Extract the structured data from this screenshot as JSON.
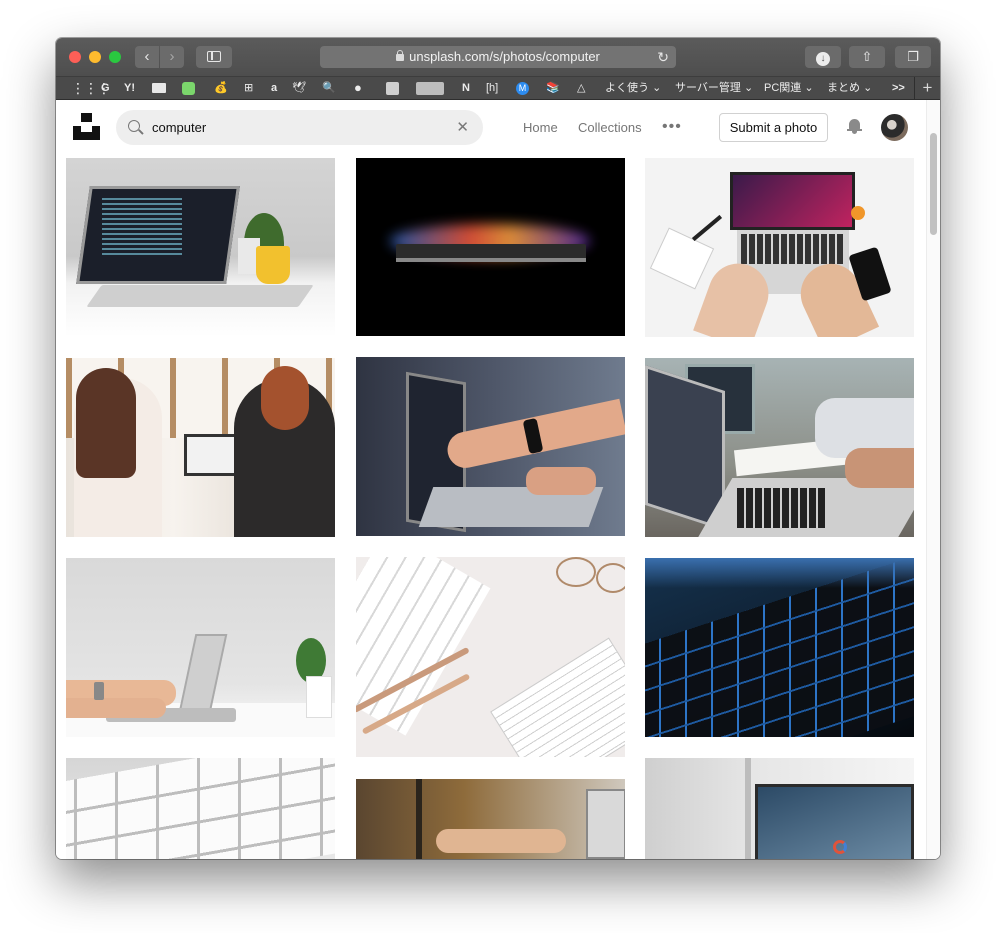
{
  "browser": {
    "url": "unsplash.com/s/photos/computer",
    "back_glyph": "‹",
    "forward_glyph": "›",
    "reload_glyph": "↻",
    "share_glyph": "⇧",
    "tabs_glyph": "❐",
    "download_glyph": "↓"
  },
  "bookmarks": {
    "items": [
      {
        "label": "G",
        "icon": "google-icon"
      },
      {
        "label": "Y!",
        "icon": "yahoo-icon"
      },
      {
        "label": "",
        "icon": "bookmark-icon-1"
      },
      {
        "label": "",
        "icon": "bookmark-icon-2"
      },
      {
        "label": "💰",
        "icon": "money-bag-icon"
      },
      {
        "label": "⊞",
        "icon": "grid-icon"
      },
      {
        "label": "a",
        "icon": "amazon-icon"
      },
      {
        "label": "🕊",
        "icon": "bird-icon"
      },
      {
        "label": "🔍",
        "icon": "magnifier-icon"
      },
      {
        "label": "●",
        "icon": "circle-icon"
      },
      {
        "label": "",
        "icon": "box-icon"
      },
      {
        "label": "",
        "icon": "folder-icon"
      },
      {
        "label": "N",
        "icon": "n-icon"
      },
      {
        "label": "[h]",
        "icon": "hatena-icon"
      },
      {
        "label": "M",
        "icon": "m-icon"
      },
      {
        "label": "📚",
        "icon": "books-icon"
      },
      {
        "label": "△",
        "icon": "triangle-icon"
      }
    ],
    "folders": [
      "よく使う",
      "サーバー管理",
      "PC関連",
      "まとめ"
    ],
    "overflow": ">>",
    "add": "+"
  },
  "header": {
    "search_value": "computer",
    "clear": "✕",
    "nav_home": "Home",
    "nav_collections": "Collections",
    "more": "•••",
    "submit_button": "Submit a photo"
  },
  "photos": [
    {
      "name": "laptop-with-code-on-desk",
      "icon": "photo"
    },
    {
      "name": "laptop-glowing-dark",
      "icon": "photo"
    },
    {
      "name": "hands-typing-laptop-top-view",
      "icon": "photo"
    },
    {
      "name": "two-women-at-laptop",
      "icon": "photo"
    },
    {
      "name": "pointing-at-laptop-screen",
      "icon": "photo"
    },
    {
      "name": "people-writing-with-laptops",
      "icon": "photo"
    },
    {
      "name": "hands-on-laptop-white-desk",
      "icon": "photo"
    },
    {
      "name": "keyboard-pens-notebook",
      "icon": "photo"
    },
    {
      "name": "backlit-keyboard",
      "icon": "photo"
    },
    {
      "name": "white-keyboard-closeup",
      "icon": "photo"
    },
    {
      "name": "person-using-laptop-window",
      "icon": "photo"
    },
    {
      "name": "monitor-on-desk",
      "icon": "photo"
    }
  ],
  "colors": {
    "titlebar": "#555555",
    "page_bg": "#ffffff",
    "search_bg": "#eeeeee"
  }
}
